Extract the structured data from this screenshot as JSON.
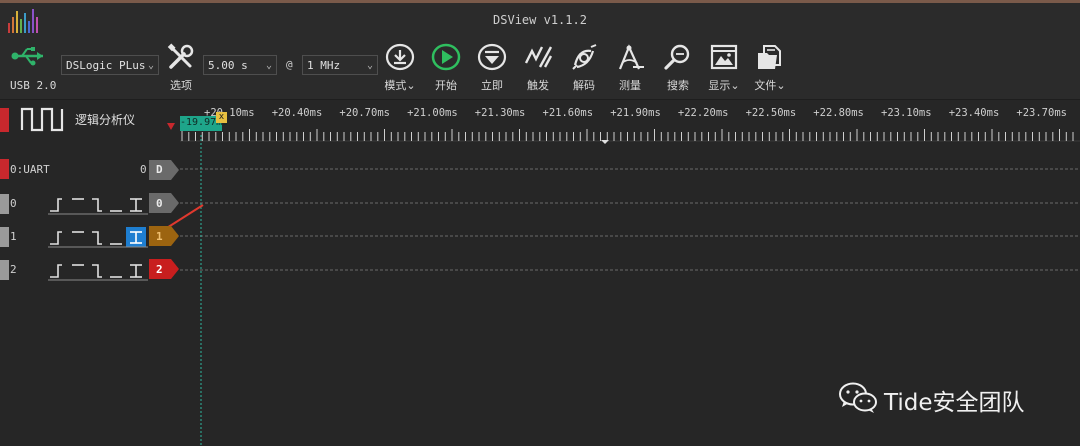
{
  "window": {
    "title": "DSView v1.1.2"
  },
  "toolbar": {
    "usb_label": "USB 2.0",
    "device": "DSLogic PLus",
    "options_label": "选项",
    "sample_time": "5.00 s",
    "at_label": "@",
    "sample_rate": "1 MHz",
    "buttons": [
      {
        "label": "模式",
        "icon": "download-icon",
        "has_dropdown": true
      },
      {
        "label": "开始",
        "icon": "play-icon"
      },
      {
        "label": "立即",
        "icon": "single-shot-icon"
      },
      {
        "label": "触发",
        "icon": "trigger-icon"
      },
      {
        "label": "解码",
        "icon": "decode-icon"
      },
      {
        "label": "测量",
        "icon": "measure-icon"
      },
      {
        "label": "搜索",
        "icon": "search-icon"
      },
      {
        "label": "显示",
        "icon": "display-icon",
        "has_dropdown": true
      },
      {
        "label": "文件",
        "icon": "file-icon",
        "has_dropdown": true
      }
    ]
  },
  "ruler": {
    "header_label": "逻辑分析仪",
    "cursor_time": "-19.97ms",
    "cursor_close": "x",
    "ticks": [
      "+20.10ms",
      "+20.40ms",
      "+20.70ms",
      "+21.00ms",
      "+21.30ms",
      "+21.60ms",
      "+21.90ms",
      "+22.20ms",
      "+22.50ms",
      "+22.80ms",
      "+23.10ms",
      "+23.40ms",
      "+23.70ms"
    ]
  },
  "channels": [
    {
      "name": "0:UART",
      "value": "0",
      "tag": "D",
      "kind": "decoder",
      "tag_color": "#6a6a6a"
    },
    {
      "name": "0",
      "tag": "0",
      "kind": "logic",
      "tag_color": "#6a6a6a"
    },
    {
      "name": "1",
      "tag": "1",
      "kind": "logic",
      "tag_color": "#9c6410",
      "selected_edge": true
    },
    {
      "name": "2",
      "tag": "2",
      "kind": "logic",
      "tag_color": "#c81e1e"
    }
  ],
  "watermark": {
    "text": "Tide安全团队"
  }
}
